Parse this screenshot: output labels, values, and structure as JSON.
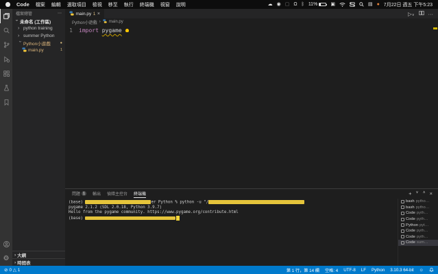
{
  "menubar": {
    "app_name": "Code",
    "menus": [
      "檔案",
      "編輯",
      "選取項目",
      "檢視",
      "移至",
      "執行",
      "終端機",
      "視窗",
      "說明"
    ],
    "icons": {
      "cloud": "☁",
      "record": "◉",
      "display_dim": "▢",
      "headphones": "Ω",
      "bluetooth": "ᛒ",
      "mirroring": "▣",
      "input_source": "▤",
      "focus_dot": "●"
    },
    "battery_percent": "11%",
    "datetime": "7月22日 週五 下午5:23"
  },
  "sidebar": {
    "header": "檔案總管",
    "more": "⋯",
    "workspace_label": "未命名 (工作區)",
    "items": [
      {
        "label": "python training"
      },
      {
        "label": "summer Python"
      },
      {
        "label": "Python小遊戲",
        "badge": "●"
      },
      {
        "label": "main.py",
        "badge": "1"
      }
    ],
    "outline_label": "大綱",
    "timeline_label": "時間表"
  },
  "editor": {
    "tab_label": "main.py",
    "tab_badge": "1",
    "breadcrumb_folder": "Python小遊戲",
    "breadcrumb_file": "main.py",
    "line_number": "1",
    "code_keyword": "import",
    "code_module": "pygame"
  },
  "panel": {
    "tabs": [
      {
        "label": "問題",
        "badge": "1"
      },
      {
        "label": "輸出"
      },
      {
        "label": "偵錯主控台"
      },
      {
        "label": "終端機"
      }
    ],
    "terminal": {
      "line1_prefix": "(base) ",
      "line1_mid": "er Python % python -u \"/",
      "line2": "pygame 2.1.2 (SDL 2.0.18, Python 3.9.7)",
      "line3": "Hello from the pygame community. https://www.pygame.org/contribute.html",
      "line4_prefix": "(base) "
    },
    "terminal_list": [
      {
        "name": "bash",
        "detail": "pytho…"
      },
      {
        "name": "bash",
        "detail": "pytho…"
      },
      {
        "name": "Code",
        "detail": "pyth…"
      },
      {
        "name": "Code",
        "detail": "pyth…"
      },
      {
        "name": "Python",
        "detail": "pyt…"
      },
      {
        "name": "Code",
        "detail": "pyth…"
      },
      {
        "name": "Code",
        "detail": "pyth…"
      },
      {
        "name": "Code",
        "detail": "sum…"
      }
    ]
  },
  "status_bar": {
    "errors": "0",
    "warnings": "1",
    "cursor_position": "第 1 行，第 14 欄",
    "indentation": "空格: 4",
    "encoding": "UTF-8",
    "eol": "LF",
    "language": "Python",
    "interpreter": "3.10.3 64-bit"
  },
  "colors": {
    "accent_blue": "#007ACC",
    "highlight_yellow": "#E5C43B",
    "warning_badge": "#D7BA7D",
    "keyword_pink": "#C586C0"
  }
}
